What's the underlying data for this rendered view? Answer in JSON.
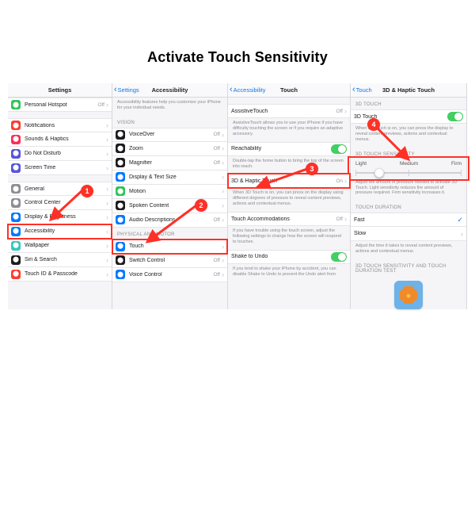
{
  "title": "Activate Touch Sensitivity",
  "callouts": [
    "1",
    "2",
    "3",
    "4"
  ],
  "panel1": {
    "header": "Settings",
    "groups": [
      [
        {
          "label": "Personal Hotspot",
          "val": "Off",
          "icon": "link-icon",
          "bg": "bg-green"
        }
      ],
      [
        {
          "label": "Notifications",
          "icon": "bell-icon",
          "bg": "bg-red"
        },
        {
          "label": "Sounds & Haptics",
          "icon": "speaker-icon",
          "bg": "bg-pink"
        },
        {
          "label": "Do Not Disturb",
          "icon": "moon-icon",
          "bg": "bg-purple"
        },
        {
          "label": "Screen Time",
          "icon": "hourglass-icon",
          "bg": "bg-purple"
        }
      ],
      [
        {
          "label": "General",
          "icon": "gear-icon",
          "bg": "bg-gray"
        },
        {
          "label": "Control Center",
          "icon": "slider-icon",
          "bg": "bg-gray"
        },
        {
          "label": "Display & Brightness",
          "icon": "brightness-icon",
          "bg": "bg-blue"
        },
        {
          "label": "Accessibility",
          "icon": "accessibility-icon",
          "bg": "bg-blue",
          "highlight": true
        },
        {
          "label": "Wallpaper",
          "icon": "wallpaper-icon",
          "bg": "bg-teal"
        },
        {
          "label": "Siri & Search",
          "icon": "siri-icon",
          "bg": "bg-black"
        },
        {
          "label": "Touch ID & Passcode",
          "icon": "fingerprint-icon",
          "bg": "bg-red"
        }
      ]
    ]
  },
  "panel2": {
    "back": "Settings",
    "header": "Accessibility",
    "intro": "Accessibility features help you customize your iPhone for your individual needs.",
    "sections": [
      {
        "title": "VISION",
        "rows": [
          {
            "label": "VoiceOver",
            "val": "Off",
            "icon": "voiceover-icon",
            "bg": "bg-black"
          },
          {
            "label": "Zoom",
            "val": "Off",
            "icon": "zoom-icon",
            "bg": "bg-black"
          },
          {
            "label": "Magnifier",
            "val": "Off",
            "icon": "magnifier-icon",
            "bg": "bg-black"
          },
          {
            "label": "Display & Text Size",
            "icon": "text-icon",
            "bg": "bg-blue"
          },
          {
            "label": "Motion",
            "icon": "motion-icon",
            "bg": "bg-green"
          },
          {
            "label": "Spoken Content",
            "icon": "speak-icon",
            "bg": "bg-black"
          },
          {
            "label": "Audio Descriptions",
            "val": "Off",
            "icon": "audio-icon",
            "bg": "bg-blue"
          }
        ]
      },
      {
        "title": "PHYSICAL AND MOTOR",
        "rows": [
          {
            "label": "Touch",
            "icon": "touch-icon",
            "bg": "bg-blue",
            "highlight": true
          },
          {
            "label": "Switch Control",
            "val": "Off",
            "icon": "switch-icon",
            "bg": "bg-black"
          },
          {
            "label": "Voice Control",
            "val": "Off",
            "icon": "voicecontrol-icon",
            "bg": "bg-blue"
          }
        ]
      }
    ]
  },
  "panel3": {
    "back": "Accessibility",
    "header": "Touch",
    "rows1": [
      {
        "label": "AssistiveTouch",
        "val": "Off"
      }
    ],
    "desc1": "AssistiveTouch allows you to use your iPhone if you have difficulty touching the screen or if you require an adaptive accessory.",
    "rows2": [
      {
        "label": "Reachability",
        "toggle": true
      }
    ],
    "desc2": "Double-tap the home button to bring the top of the screen into reach.",
    "rows3": [
      {
        "label": "3D & Haptic Touch",
        "val": "On",
        "highlight": true
      }
    ],
    "desc3": "When 3D Touch is on, you can press on the display using different degrees of pressure to reveal content previews, actions and contextual menus.",
    "rows4": [
      {
        "label": "Touch Accommodations",
        "val": "Off"
      }
    ],
    "desc4": "If you have trouble using the touch screen, adjust the following settings to change how the screen will respond to touches.",
    "rows5": [
      {
        "label": "Shake to Undo",
        "toggle": true
      }
    ],
    "desc5": "If you tend to shake your iPhone by accident, you can disable Shake to Undo to prevent the Undo alert from"
  },
  "panel4": {
    "back": "Touch",
    "header": "3D & Haptic Touch",
    "section1": "3D TOUCH",
    "row1": {
      "label": "3D Touch",
      "toggle": true
    },
    "desc1": "When 3D Touch is on, you can press the display to reveal content previews, actions and contextual menus.",
    "section2": "3D TOUCH SENSITIVITY",
    "slider": {
      "labels": [
        "Light",
        "Medium",
        "Firm"
      ],
      "highlight": true
    },
    "desc2": "Adjust the amount of pressure needed to activate 3D Touch. Light sensitivity reduces the amount of pressure required. Firm sensitivity increases it.",
    "section3": "TOUCH DURATION",
    "rows3": [
      {
        "label": "Fast",
        "checked": true
      },
      {
        "label": "Slow"
      }
    ],
    "desc3": "Adjust the time it takes to reveal content previews, actions and contextual menus.",
    "section4": "3D TOUCH SENSITIVITY AND TOUCH DURATION TEST"
  }
}
